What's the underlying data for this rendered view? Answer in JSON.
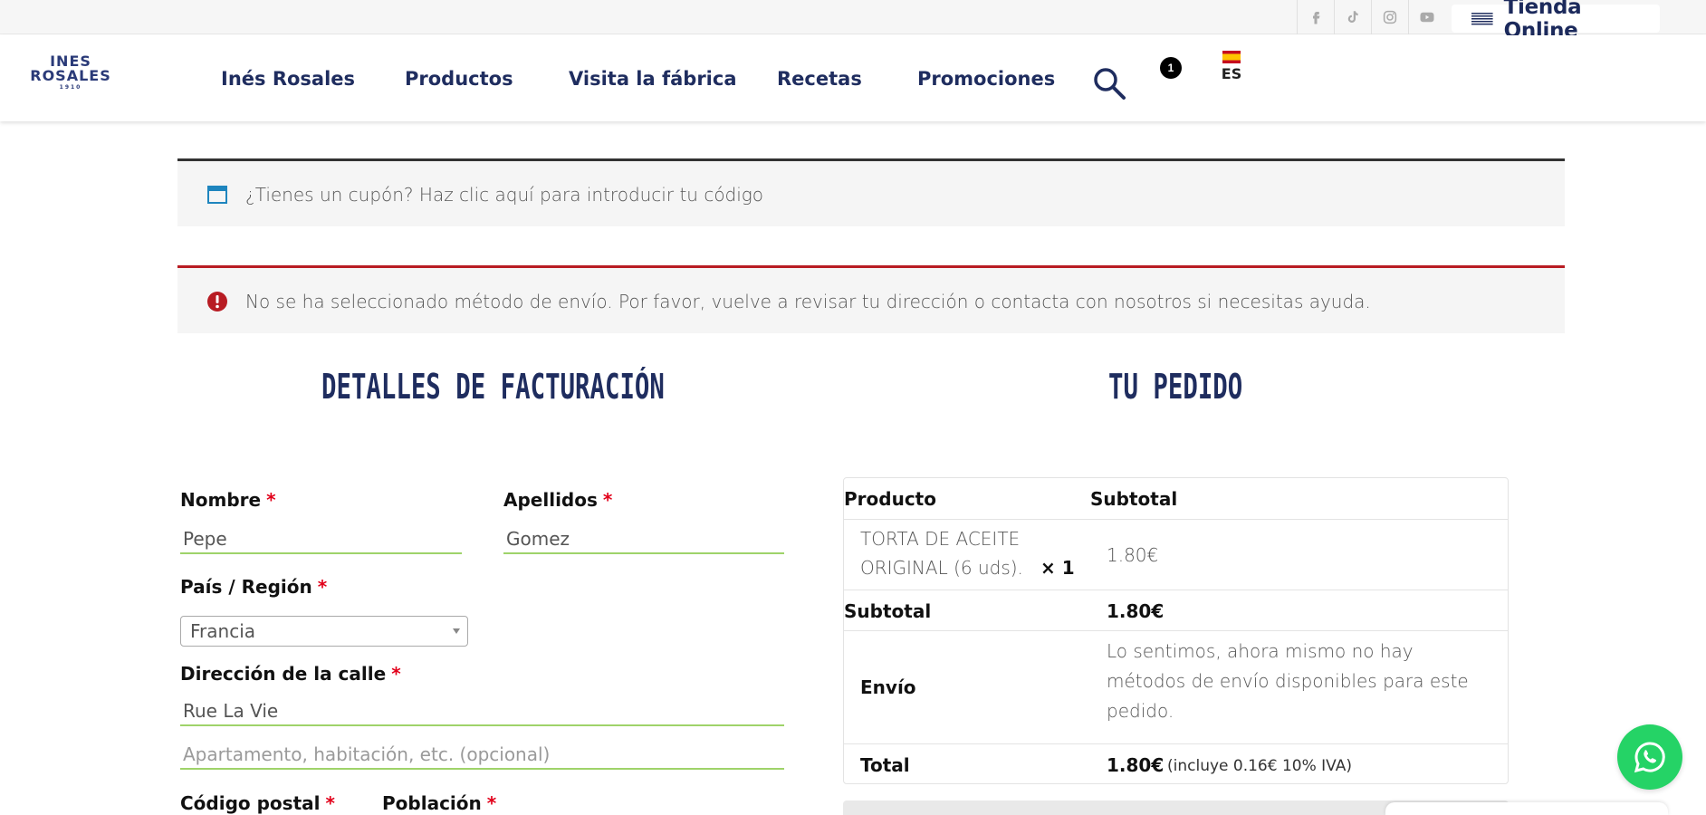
{
  "topbar": {
    "social_icons": [
      "facebook-icon",
      "tiktok-icon",
      "instagram-icon",
      "youtube-icon"
    ],
    "store_label": "Tienda Online"
  },
  "header": {
    "logo_line1": "INES",
    "logo_line2": "ROSALES",
    "logo_line3": "1910",
    "nav": [
      "Inés Rosales",
      "Productos",
      "Visita la fábrica",
      "Recetas",
      "Promociones"
    ],
    "cart_count": "1",
    "language": "ES"
  },
  "notices": {
    "coupon": "¿Tienes un cupón? Haz clic aquí para introducir tu código",
    "error": "No se ha seleccionado método de envío. Por favor, vuelve a revisar tu dirección o contacta con nosotros si necesitas ayuda."
  },
  "billing": {
    "title": "DETALLES DE FACTURACIÓN",
    "first_name_label": "Nombre",
    "first_name_value": "Pepe",
    "last_name_label": "Apellidos",
    "last_name_value": "Gomez",
    "country_label": "País / Región",
    "country_value": "Francia",
    "street_label": "Dirección de la calle",
    "street_value": "Rue La Vie",
    "street2_placeholder": "Apartamento, habitación, etc. (opcional)",
    "postcode_label": "Código postal",
    "city_label": "Población",
    "required_mark": "*"
  },
  "order": {
    "title": "TU PEDIDO",
    "col_product": "Producto",
    "col_subtotal": "Subtotal",
    "item_name_line1": "TORTA DE ACEITE",
    "item_name_line2": "ORIGINAL (6 uds).",
    "item_qty": "× 1",
    "item_price": "1.80€",
    "subtotal_label": "Subtotal",
    "subtotal_value": "1.80€",
    "shipping_label": "Envío",
    "shipping_line1": "Lo sentimos, ahora mismo no hay",
    "shipping_line2": "métodos de envío disponibles para este",
    "shipping_line3": "pedido.",
    "total_label": "Total",
    "total_value": "1.80€",
    "total_note": "(incluye 0.16€ 10% IVA)"
  },
  "colors": {
    "navy": "#1f2d5f",
    "error_red": "#b81c23",
    "field_green": "#9fd36a",
    "whatsapp": "#25d366"
  }
}
